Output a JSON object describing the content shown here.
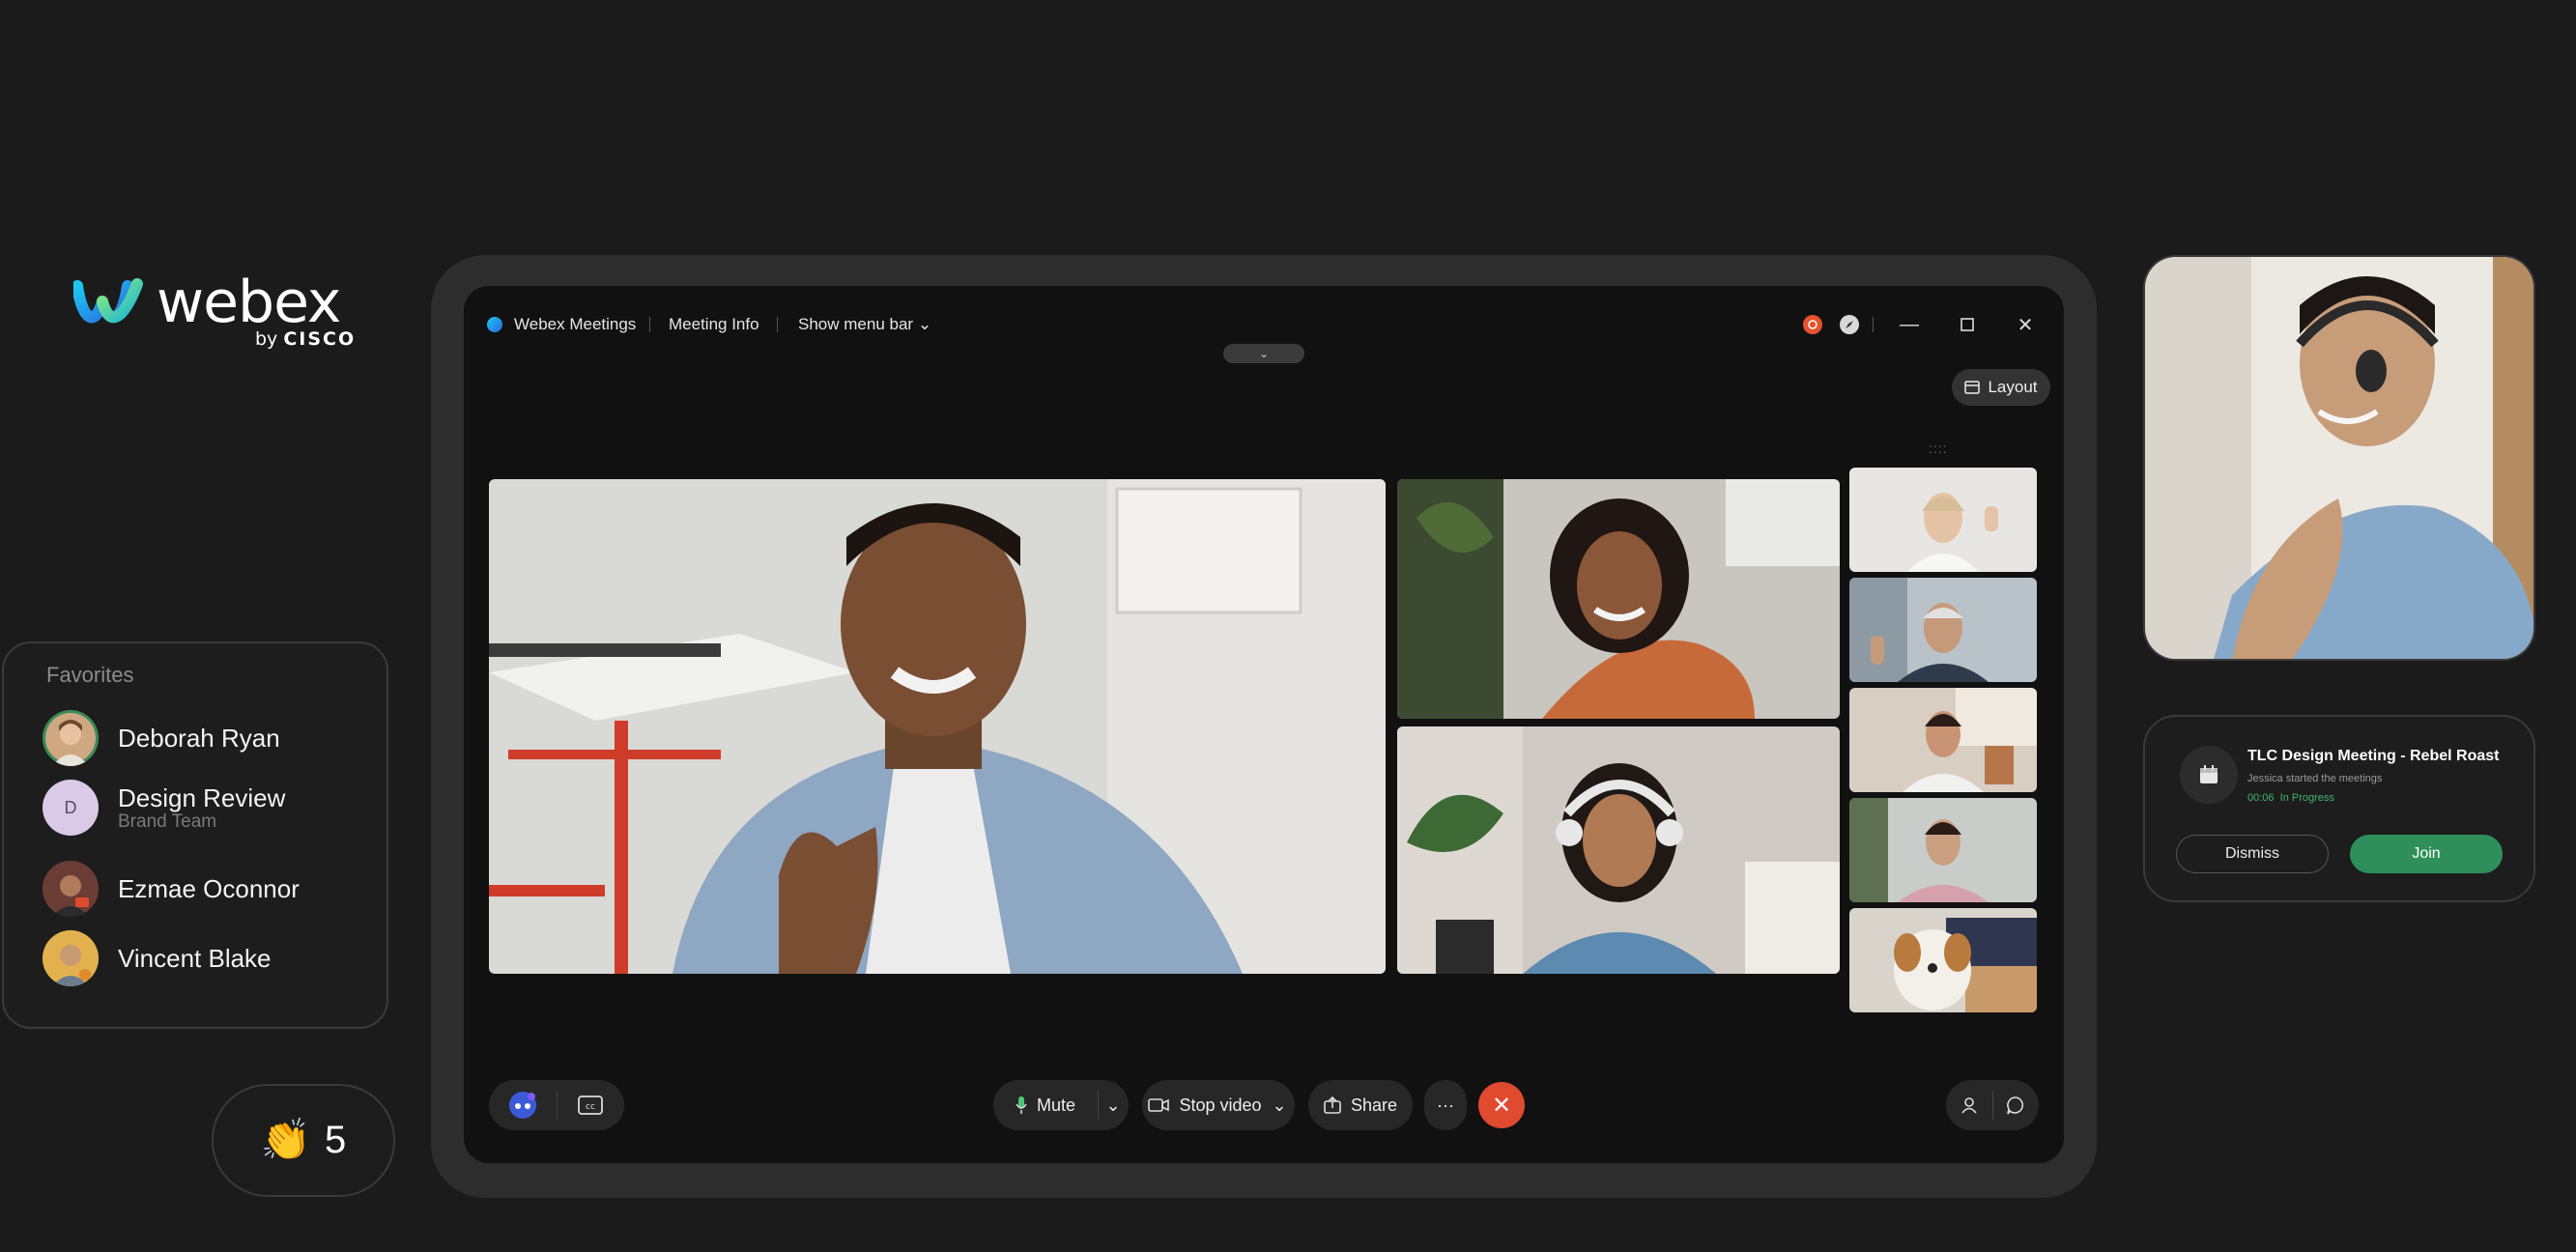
{
  "brand": {
    "word": "webex",
    "by": "by",
    "company": "CISCO"
  },
  "favorites": {
    "title": "Favorites",
    "items": [
      {
        "name": "Deborah Ryan",
        "sub": "",
        "avatar": "photo"
      },
      {
        "name": "Design Review",
        "sub": "Brand Team",
        "avatar": "D"
      },
      {
        "name": "Ezmae Oconnor",
        "sub": "",
        "avatar": "photo"
      },
      {
        "name": "Vincent Blake",
        "sub": "",
        "avatar": "photo"
      }
    ]
  },
  "reaction": {
    "emoji": "👏",
    "count": "5"
  },
  "meeting_window": {
    "app_name": "Webex Meetings",
    "meeting_info": "Meeting Info",
    "show_menu_bar": "Show menu bar",
    "layout_label": "Layout",
    "controls": {
      "mute": "Mute",
      "stop_video": "Stop video",
      "share": "Share",
      "more": "···"
    },
    "colors": {
      "end_call": "#e04a2f",
      "recording": "#e5522d"
    }
  },
  "notification": {
    "title": "TLC Design Meeting - Rebel Roast",
    "subtitle": "Jessica started the meetings",
    "time": "00:06",
    "status": "In Progress",
    "dismiss": "Dismiss",
    "join": "Join",
    "join_color": "#2e8f5a"
  }
}
